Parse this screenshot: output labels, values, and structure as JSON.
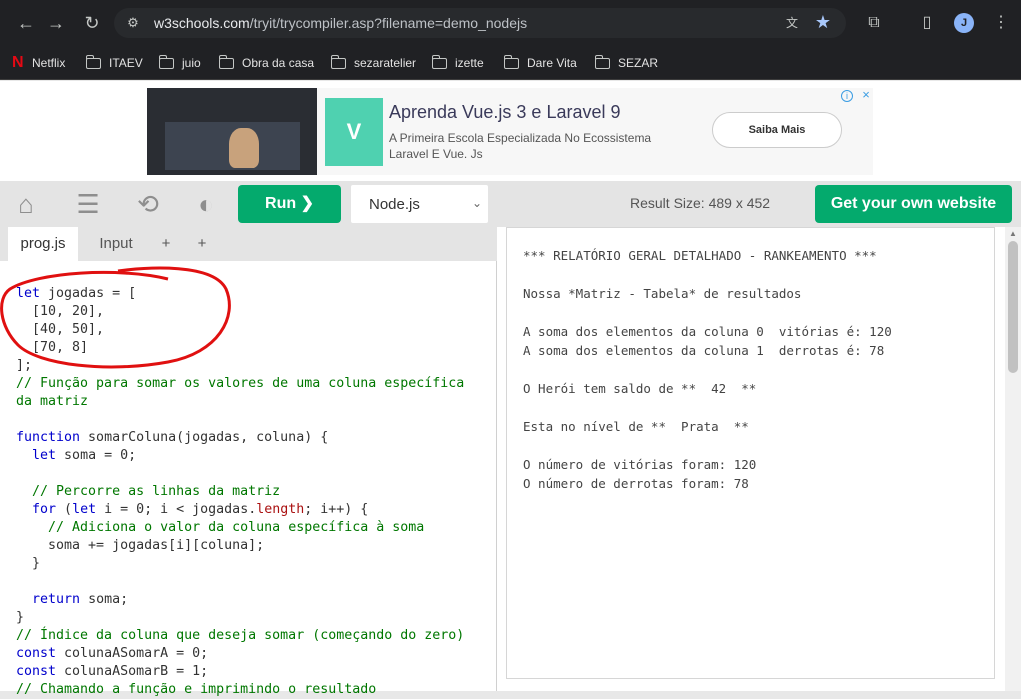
{
  "browser": {
    "url_host": "w3schools.com",
    "url_path": "/tryit/trycompiler.asp?filename=demo_nodejs",
    "avatar_letter": "J"
  },
  "bookmarks": [
    "Netflix",
    "ITAEV",
    "juio",
    "Obra da casa",
    "sezaratelier",
    "izette",
    "Dare Vita",
    "SEZAR"
  ],
  "ad": {
    "title": "Aprenda Vue.js 3 e Laravel 9",
    "subtitle": "A Primeira Escola Especializada No Ecossistema Laravel E Vue. Js",
    "cta": "Saiba Mais",
    "info": "i",
    "close": "×"
  },
  "toolbar": {
    "run_label": "Run ❯",
    "language": "Node.js",
    "result_size": "Result Size: 489 x 452",
    "get_website": "Get your own website"
  },
  "tabs": [
    "prog.js",
    "Input",
    "+",
    "+"
  ],
  "result": {
    "lines": [
      "*** RELATÓRIO GERAL DETALHADO - RANKEAMENTO ***",
      "",
      "Nossa *Matriz - Tabela* de resultados",
      "",
      "A soma dos elementos da coluna 0  vitórias é: 120",
      "A soma dos elementos da coluna 1  derrotas é: 78",
      "",
      "O Herói tem saldo de **  42  **",
      "",
      "Esta no nível de **  Prata  **",
      "",
      "O número de vitórias foram: 120",
      "O número de derrotas foram: 78"
    ]
  }
}
